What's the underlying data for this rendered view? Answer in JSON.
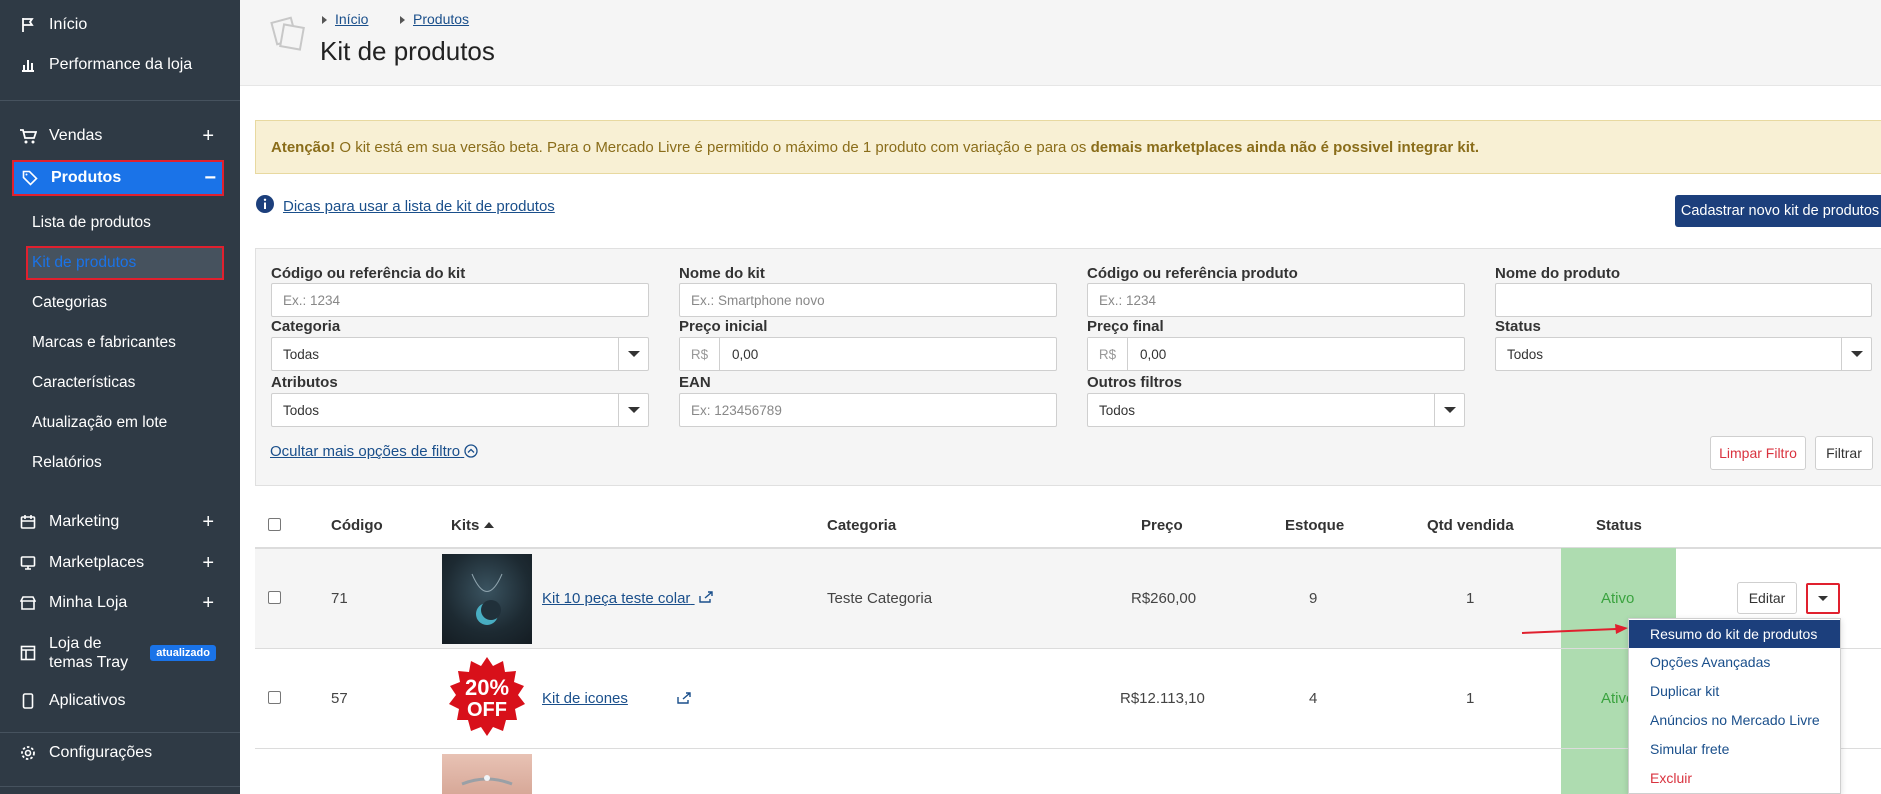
{
  "sidebar": {
    "items": [
      {
        "label": "Início"
      },
      {
        "label": "Performance da loja"
      },
      {
        "label": "Vendas"
      },
      {
        "label": "Produtos"
      },
      {
        "label": "Marketing"
      },
      {
        "label": "Marketplaces"
      },
      {
        "label": "Minha Loja"
      },
      {
        "label": "Loja de temas Tray",
        "badge": "atualizado"
      },
      {
        "label": "Aplicativos"
      },
      {
        "label": "Configurações"
      }
    ],
    "subitems": [
      {
        "label": "Lista de produtos"
      },
      {
        "label": "Kit de produtos"
      },
      {
        "label": "Categorias"
      },
      {
        "label": "Marcas e fabricantes"
      },
      {
        "label": "Características"
      },
      {
        "label": "Atualização em lote"
      },
      {
        "label": "Relatórios"
      }
    ],
    "plus": "+",
    "minus": "−"
  },
  "breadcrumb": [
    "Início",
    "Produtos"
  ],
  "page_title": "Kit de produtos",
  "alert": {
    "strong": "Atenção!",
    "text": " O kit está em sua versão beta. Para o Mercado Livre é permitido o máximo de 1 produto com variação e para os ",
    "strong2": "demais marketplaces ainda não é possivel integrar kit."
  },
  "tips_link": "Dicas para usar a lista de kit de produtos",
  "new_kit_button": "Cadastrar novo kit de produtos",
  "filters": {
    "kit_code": {
      "label": "Código ou referência do kit",
      "placeholder": "Ex.: 1234"
    },
    "kit_name": {
      "label": "Nome do kit",
      "placeholder": "Ex.: Smartphone novo"
    },
    "product_code": {
      "label": "Código ou referência produto",
      "placeholder": "Ex.: 1234"
    },
    "product_name": {
      "label": "Nome do produto",
      "placeholder": ""
    },
    "category": {
      "label": "Categoria",
      "value": "Todas"
    },
    "price_start": {
      "label": "Preço inicial",
      "prefix": "R$",
      "value": "0,00"
    },
    "price_end": {
      "label": "Preço final",
      "prefix": "R$",
      "value": "0,00"
    },
    "status": {
      "label": "Status",
      "value": "Todos"
    },
    "attributes": {
      "label": "Atributos",
      "value": "Todos"
    },
    "ean": {
      "label": "EAN",
      "placeholder": "Ex: 123456789"
    },
    "other": {
      "label": "Outros filtros",
      "value": "Todos"
    },
    "hide_more": "Ocultar mais opções de filtro",
    "clear_button": "Limpar Filtro",
    "filter_button": "Filtrar"
  },
  "table": {
    "headers": [
      "Código",
      "Kits",
      "Categoria",
      "Preço",
      "Estoque",
      "Qtd vendida",
      "Status"
    ],
    "rows": [
      {
        "code": "71",
        "name": "Kit 10 peça teste colar",
        "category": "Teste Categoria",
        "price": "R$260,00",
        "stock": "9",
        "sold": "1",
        "status": "Ativo"
      },
      {
        "code": "57",
        "name": "Kit de icones",
        "category": "",
        "price": "R$12.113,10",
        "stock": "4",
        "sold": "1",
        "status": "Ativo"
      }
    ],
    "edit_button": "Editar"
  },
  "thumb_text": {
    "line1": "20%",
    "line2": "OFF"
  },
  "dropdown_menu": [
    {
      "label": "Resumo do kit de produtos"
    },
    {
      "label": "Opções Avançadas"
    },
    {
      "label": "Duplicar kit"
    },
    {
      "label": "Anúncios no Mercado Livre"
    },
    {
      "label": "Simular frete"
    },
    {
      "label": "Excluir"
    }
  ],
  "colors": {
    "sidebar": "#2f3a45",
    "active": "#1a73e8",
    "highlight": "#e0202e",
    "primary": "#1c3f7c",
    "status_bg": "#aedcb0"
  }
}
